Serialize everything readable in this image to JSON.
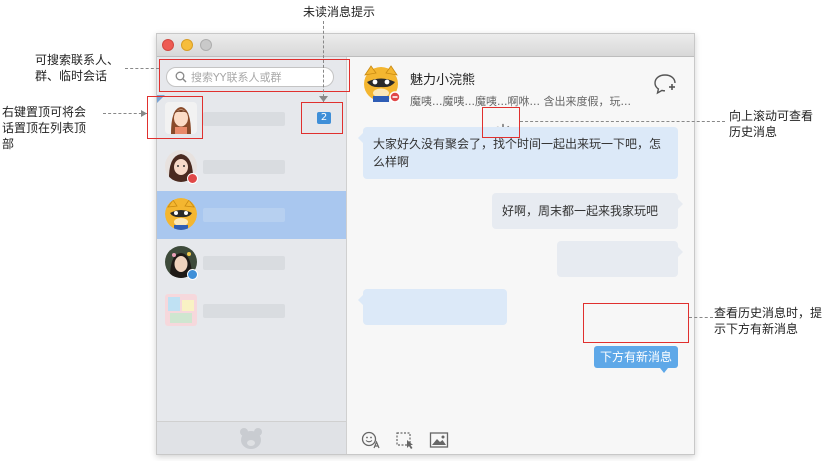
{
  "annotations": {
    "unread_hint": "未读消息提示",
    "search_hint": "可搜索联系人、\n群、临时会话",
    "pin_hint": "右键置顶可将会\n话置顶在列表顶\n部",
    "scroll_hint": "向上滚动可查看\n历史消息",
    "new_msg_hint": "查看历史消息时，提\n示下方有新消息"
  },
  "sidebar": {
    "search_placeholder": "搜索YY联系人或群",
    "unread_count": "2"
  },
  "chat": {
    "contact_name": "魅力小浣熊",
    "contact_signature": "魔咦...魔咦...魔咦...啊咻... 含出来度假，玩...",
    "messages": [
      {
        "side": "left",
        "text": "大家好久没有聚会了，找个时间一起出来玩一下吧，怎么样啊"
      },
      {
        "side": "right",
        "text": "好啊，周末都一起来我家玩吧"
      }
    ],
    "new_message_button": "下方有新消息"
  },
  "colors": {
    "accent": "#5ea8e8",
    "selected_row": "#a9c7ef",
    "annotation_box": "#e0302e",
    "unread_badge": "#3f8fd8"
  },
  "icons": [
    "search-icon",
    "new-chat-icon",
    "loading-spinner-icon",
    "emoji-icon",
    "screenshot-icon",
    "image-icon",
    "yy-bear-icon"
  ]
}
